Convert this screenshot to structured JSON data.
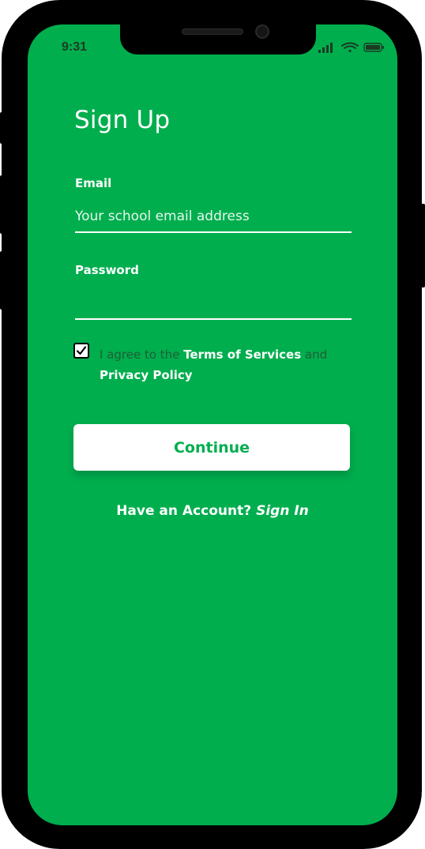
{
  "status_bar": {
    "time": "9:31",
    "icons": [
      "signal-icon",
      "wifi-icon",
      "battery-icon"
    ]
  },
  "form": {
    "title": "Sign Up",
    "email": {
      "label": "Email",
      "value": "",
      "placeholder": "Your school email address"
    },
    "password": {
      "label": "Password",
      "value": "",
      "placeholder": ""
    },
    "agreement": {
      "checked": true,
      "prefix": "I agree to the ",
      "terms_link": "Terms of Services",
      "middle": " and",
      "privacy_link": "Privacy Policy"
    },
    "continue_label": "Continue"
  },
  "footer": {
    "prompt": "Have an Account?",
    "sign_in_link": "Sign In"
  },
  "colors": {
    "primary": "#00AE4E",
    "white": "#FFFFFF",
    "muted_text": "#1F5F35"
  }
}
